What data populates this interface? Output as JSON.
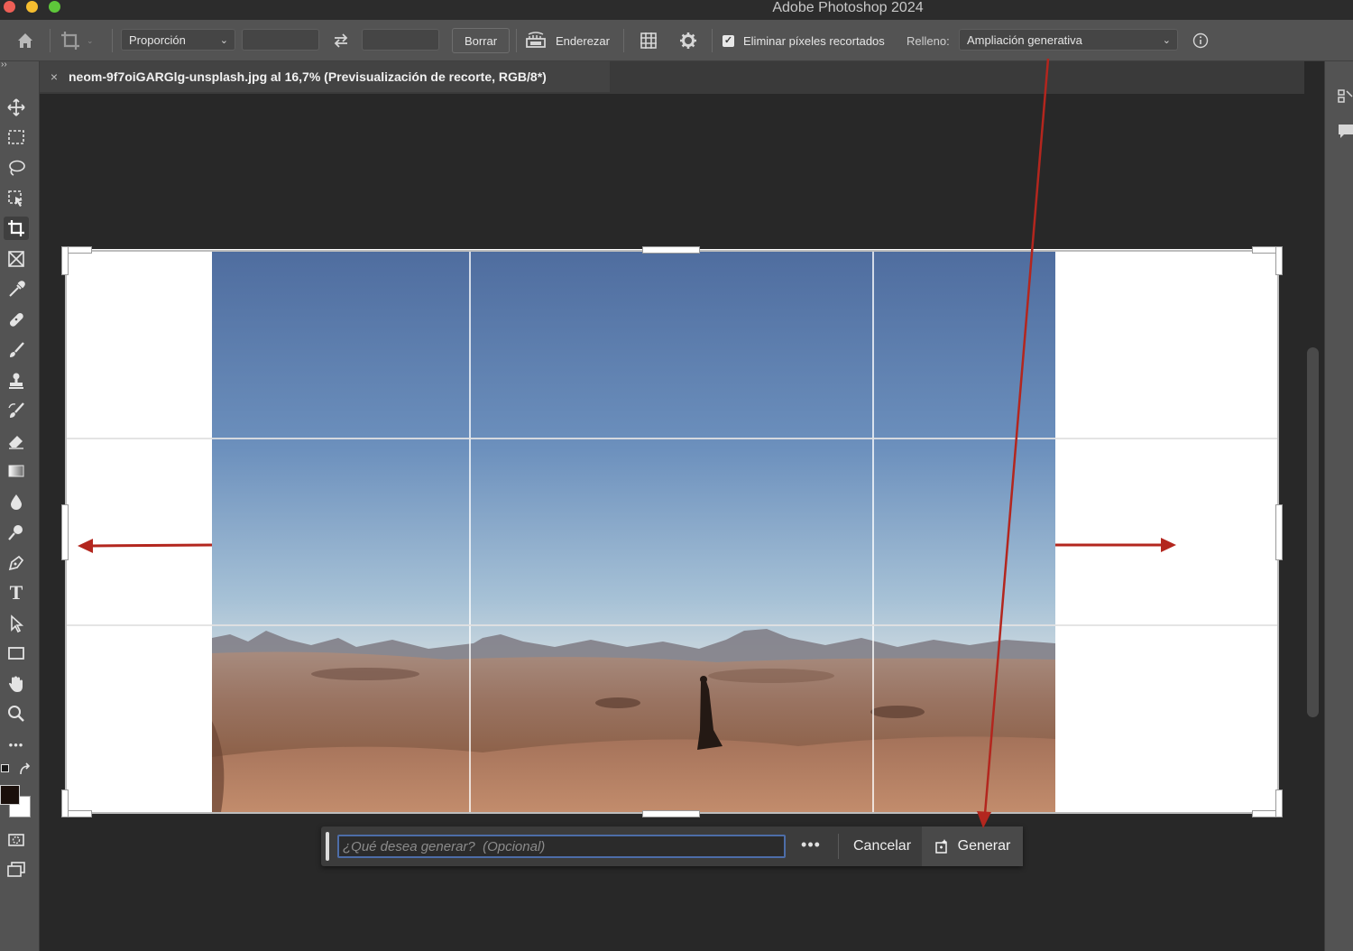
{
  "window": {
    "title": "Adobe Photoshop 2024",
    "traffic_colors": [
      "#ee5f56",
      "#f5bd2f",
      "#5ec73a"
    ]
  },
  "options_bar": {
    "ratio_select": "Proporción",
    "width_value": "",
    "height_value": "",
    "clear_label": "Borrar",
    "straighten_label": "Enderezar",
    "delete_cropped_label": "Eliminar píxeles recortados",
    "delete_cropped_checked": true,
    "fill_label": "Relleno:",
    "fill_select": "Ampliación generativa",
    "icons": [
      "home-icon",
      "crop-tool-icon",
      "swap-icon",
      "straighten-icon",
      "grid-overlay-icon",
      "gear-icon",
      "info-icon"
    ]
  },
  "document": {
    "tab_title": "neom-9f7oiGARGlg-unsplash.jpg al 16,7% (Previsualización de recorte, RGB/8*)",
    "close_glyph": "×"
  },
  "toolbar": {
    "collapse_glyph": "››",
    "tools": [
      "move-tool",
      "marquee-tool",
      "lasso-tool",
      "object-selection-tool",
      "crop-tool",
      "frame-tool",
      "eyedropper-tool",
      "healing-brush-tool",
      "brush-tool",
      "clone-stamp-tool",
      "history-brush-tool",
      "eraser-tool",
      "gradient-tool",
      "blur-tool",
      "dodge-tool",
      "pen-tool",
      "type-tool",
      "path-selection-tool",
      "rectangle-tool",
      "hand-tool",
      "zoom-tool",
      "more-tools",
      "quick-mask",
      "screen-mode"
    ],
    "active_tool": "crop-tool",
    "type_tool_glyph": "T",
    "more_glyph": "•••",
    "foreground_color": "#1a0f0b",
    "background_color": "#ffffff"
  },
  "generative_bar": {
    "placeholder": "¿Qué desea generar?  (Opcional)",
    "more_glyph": "•••",
    "cancel_label": "Cancelar",
    "generate_label": "Generar"
  },
  "annotation": {
    "arrow_color": "#b3261e"
  }
}
